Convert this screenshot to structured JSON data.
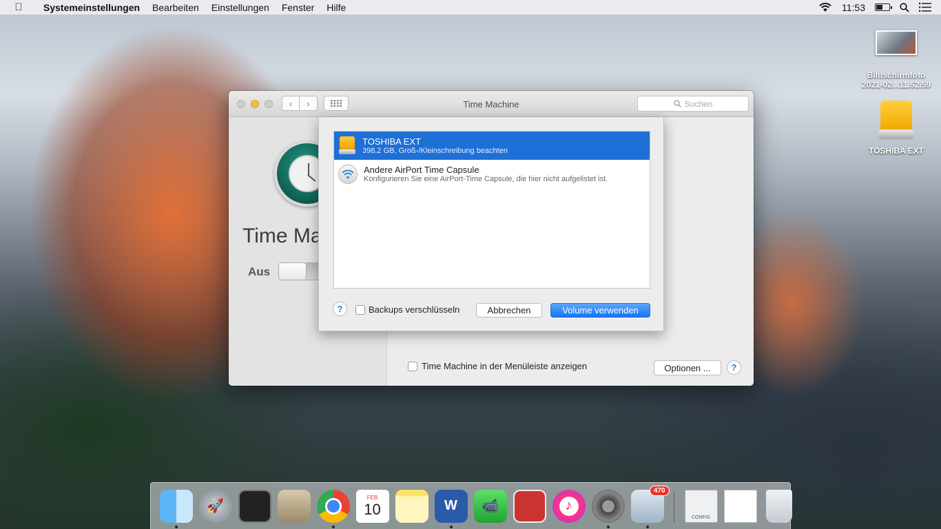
{
  "menubar": {
    "apple": "",
    "app_name": "Systemeinstellungen",
    "items": [
      "Bearbeiten",
      "Einstellungen",
      "Fenster",
      "Hilfe"
    ],
    "clock": "11:53"
  },
  "desktop": {
    "screenshot_name_line1": "Bildschirmfoto",
    "screenshot_name_line2": "2021-02...11.52.59",
    "drive_name": "TOSHIBA EXT"
  },
  "window": {
    "title": "Time Machine",
    "search_placeholder": "Suchen",
    "heading": "Time Machine",
    "switch_label": "Aus",
    "show_in_menubar_label": "Time Machine in der Menüleiste anzeigen",
    "options_label": "Optionen ...",
    "help_label": "?"
  },
  "sheet": {
    "disks": [
      {
        "name": "TOSHIBA EXT",
        "desc": "398,2 GB, Groß-/Kleinschreibung beachten",
        "icon": "drive-icon",
        "selected": true
      },
      {
        "name": "Andere AirPort Time Capsule",
        "desc": "Konfigurieren Sie eine AirPort-Time Capsule, die hier nicht aufgelistet ist.",
        "icon": "airport-icon",
        "selected": false
      }
    ],
    "help_label": "?",
    "encrypt_label": "Backups verschlüsseln",
    "cancel_label": "Abbrechen",
    "use_label": "Volume verwenden"
  },
  "dock": {
    "calendar_month": "FEB",
    "calendar_day": "10",
    "word_letter": "W",
    "mail_badge": "470",
    "config_label": "CONFIG"
  },
  "colors": {
    "selection": "#1e6fd6",
    "accent_button": "#1676f3"
  }
}
